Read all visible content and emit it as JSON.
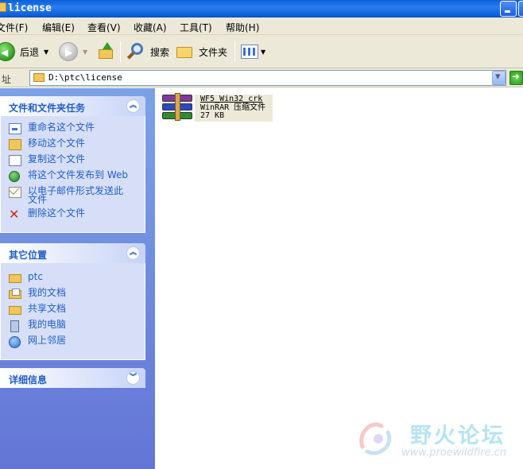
{
  "window": {
    "title": "license"
  },
  "menubar": {
    "items": [
      "文件(F)",
      "编辑(E)",
      "查看(V)",
      "收藏(A)",
      "工具(T)",
      "帮助(H)"
    ]
  },
  "toolbar": {
    "back_label": "后退",
    "search_label": "搜索",
    "folders_label": "文件夹"
  },
  "address": {
    "label": "址",
    "path": "D:\\ptc\\license"
  },
  "tasks_panel": {
    "title": "文件和文件夹任务",
    "items": [
      {
        "label": "重命名这个文件",
        "icon": "rename-icon"
      },
      {
        "label": "移动这个文件",
        "icon": "move-icon"
      },
      {
        "label": "复制这个文件",
        "icon": "copy-icon"
      },
      {
        "label": "将这个文件发布到 Web",
        "icon": "web-publish-icon"
      },
      {
        "label": "以电子邮件形式发送此文件",
        "icon": "email-icon"
      },
      {
        "label": "删除这个文件",
        "icon": "delete-icon"
      }
    ]
  },
  "places_panel": {
    "title": "其它位置",
    "items": [
      {
        "label": "ptc",
        "icon": "folder-icon"
      },
      {
        "label": "我的文档",
        "icon": "my-documents-icon"
      },
      {
        "label": "共享文档",
        "icon": "shared-folder-icon"
      },
      {
        "label": "我的电脑",
        "icon": "my-computer-icon"
      },
      {
        "label": "网上邻居",
        "icon": "network-places-icon"
      }
    ]
  },
  "details_panel": {
    "title": "详细信息"
  },
  "files": [
    {
      "name": "WF5_Win32_crk",
      "type": "WinRAR 压缩文件",
      "size": "27 KB",
      "icon": "winrar-archive-icon"
    }
  ],
  "watermark": {
    "name": "野火论坛",
    "url": "www.proewildfire.cn"
  },
  "colors": {
    "title_bar": "#0a5fd8",
    "panel_text": "#215dc6",
    "left_pane": "#7ba2e7",
    "delete_red": "#d0211d"
  }
}
